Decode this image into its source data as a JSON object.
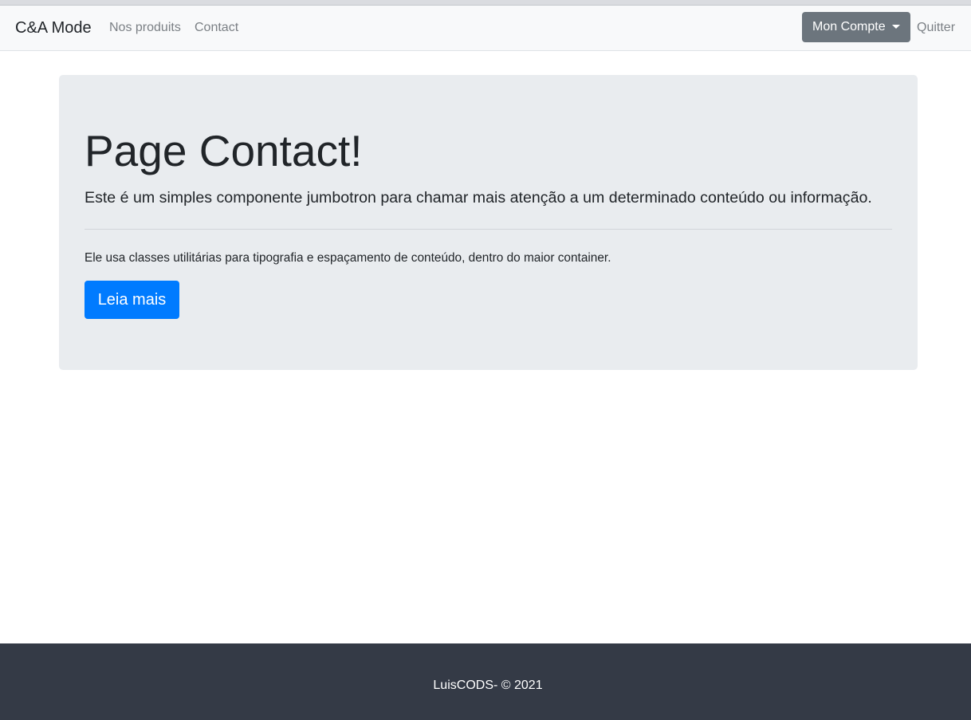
{
  "navbar": {
    "brand": "C&A Mode",
    "links": [
      {
        "label": "Nos produits"
      },
      {
        "label": "Contact"
      }
    ],
    "account_button": "Mon Compte",
    "logout_link": "Quitter"
  },
  "jumbotron": {
    "title": "Page Contact!",
    "lead": "Este é um simples componente jumbotron para chamar mais atenção a um determinado conteúdo ou informação.",
    "body": "Ele usa classes utilitárias para tipografia e espaçamento de conteúdo, dentro do maior container.",
    "button": "Leia mais"
  },
  "footer": {
    "text": "LuisCODS- © 2021"
  },
  "colors": {
    "navbar_bg": "#f8f9fa",
    "jumbotron_bg": "#e9ecef",
    "primary": "#007bff",
    "secondary": "#6c757d",
    "footer_bg": "#343a46"
  }
}
